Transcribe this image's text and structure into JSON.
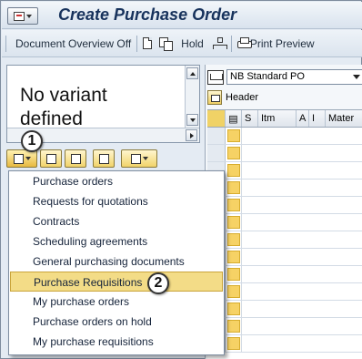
{
  "window": {
    "title": "Create Purchase Order"
  },
  "toolbar": {
    "document_overview": "Document Overview Off",
    "hold": "Hold",
    "print_preview": "Print Preview"
  },
  "variant_panel": {
    "text": "No variant defined"
  },
  "right_pane": {
    "order_type": "NB Standard PO",
    "header_label": "Header",
    "columns": [
      "S",
      "Itm",
      "A",
      "I",
      "Mater"
    ]
  },
  "dropdown_menu": {
    "items": [
      "Purchase orders",
      "Requests for quotations",
      "Contracts",
      "Scheduling agreements",
      "General purchasing documents",
      "Purchase Requisitions",
      "My purchase orders",
      "Purchase orders on hold",
      "My purchase requisitions"
    ],
    "selected": "Purchase Requisitions"
  },
  "callouts": {
    "step1": "1",
    "step2": "2"
  },
  "colors": {
    "title_text": "#17325c",
    "selection": "#f3dc87",
    "cell_marker": "#f6d265"
  }
}
